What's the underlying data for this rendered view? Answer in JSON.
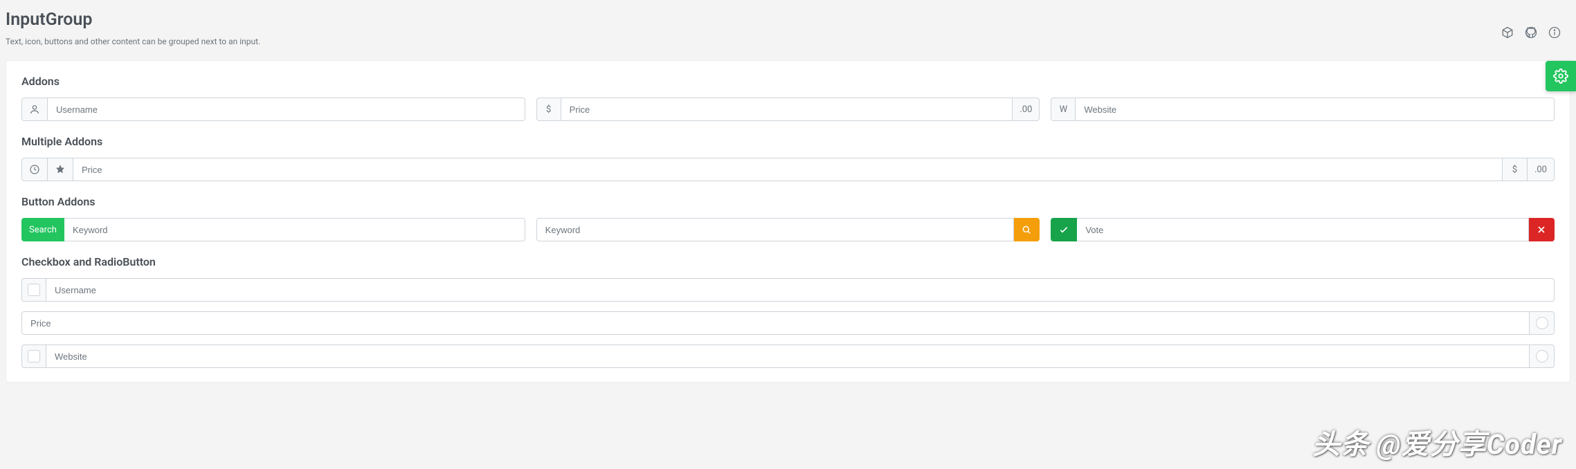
{
  "page": {
    "title": "InputGroup",
    "subtitle": "Text, icon, buttons and other content can be grouped next to an input."
  },
  "sections": {
    "addons": "Addons",
    "multiple": "Multiple Addons",
    "button": "Button Addons",
    "checkbox": "Checkbox and RadioButton"
  },
  "addons_row": {
    "username": {
      "placeholder": "Username"
    },
    "price": {
      "prefix": "$",
      "placeholder": "Price",
      "suffix": ".00"
    },
    "website": {
      "prefix": "W",
      "placeholder": "Website"
    }
  },
  "multiple_row": {
    "placeholder": "Price",
    "suffix_currency": "$",
    "suffix_decimal": ".00"
  },
  "button_row": {
    "search_label": "Search",
    "keyword1": {
      "placeholder": "Keyword"
    },
    "keyword2": {
      "placeholder": "Keyword"
    },
    "vote": {
      "placeholder": "Vote"
    }
  },
  "checkbox_row": {
    "username": {
      "placeholder": "Username"
    },
    "price": {
      "placeholder": "Price"
    },
    "website": {
      "placeholder": "Website"
    }
  },
  "watermark": "头条 @爱分享Coder"
}
